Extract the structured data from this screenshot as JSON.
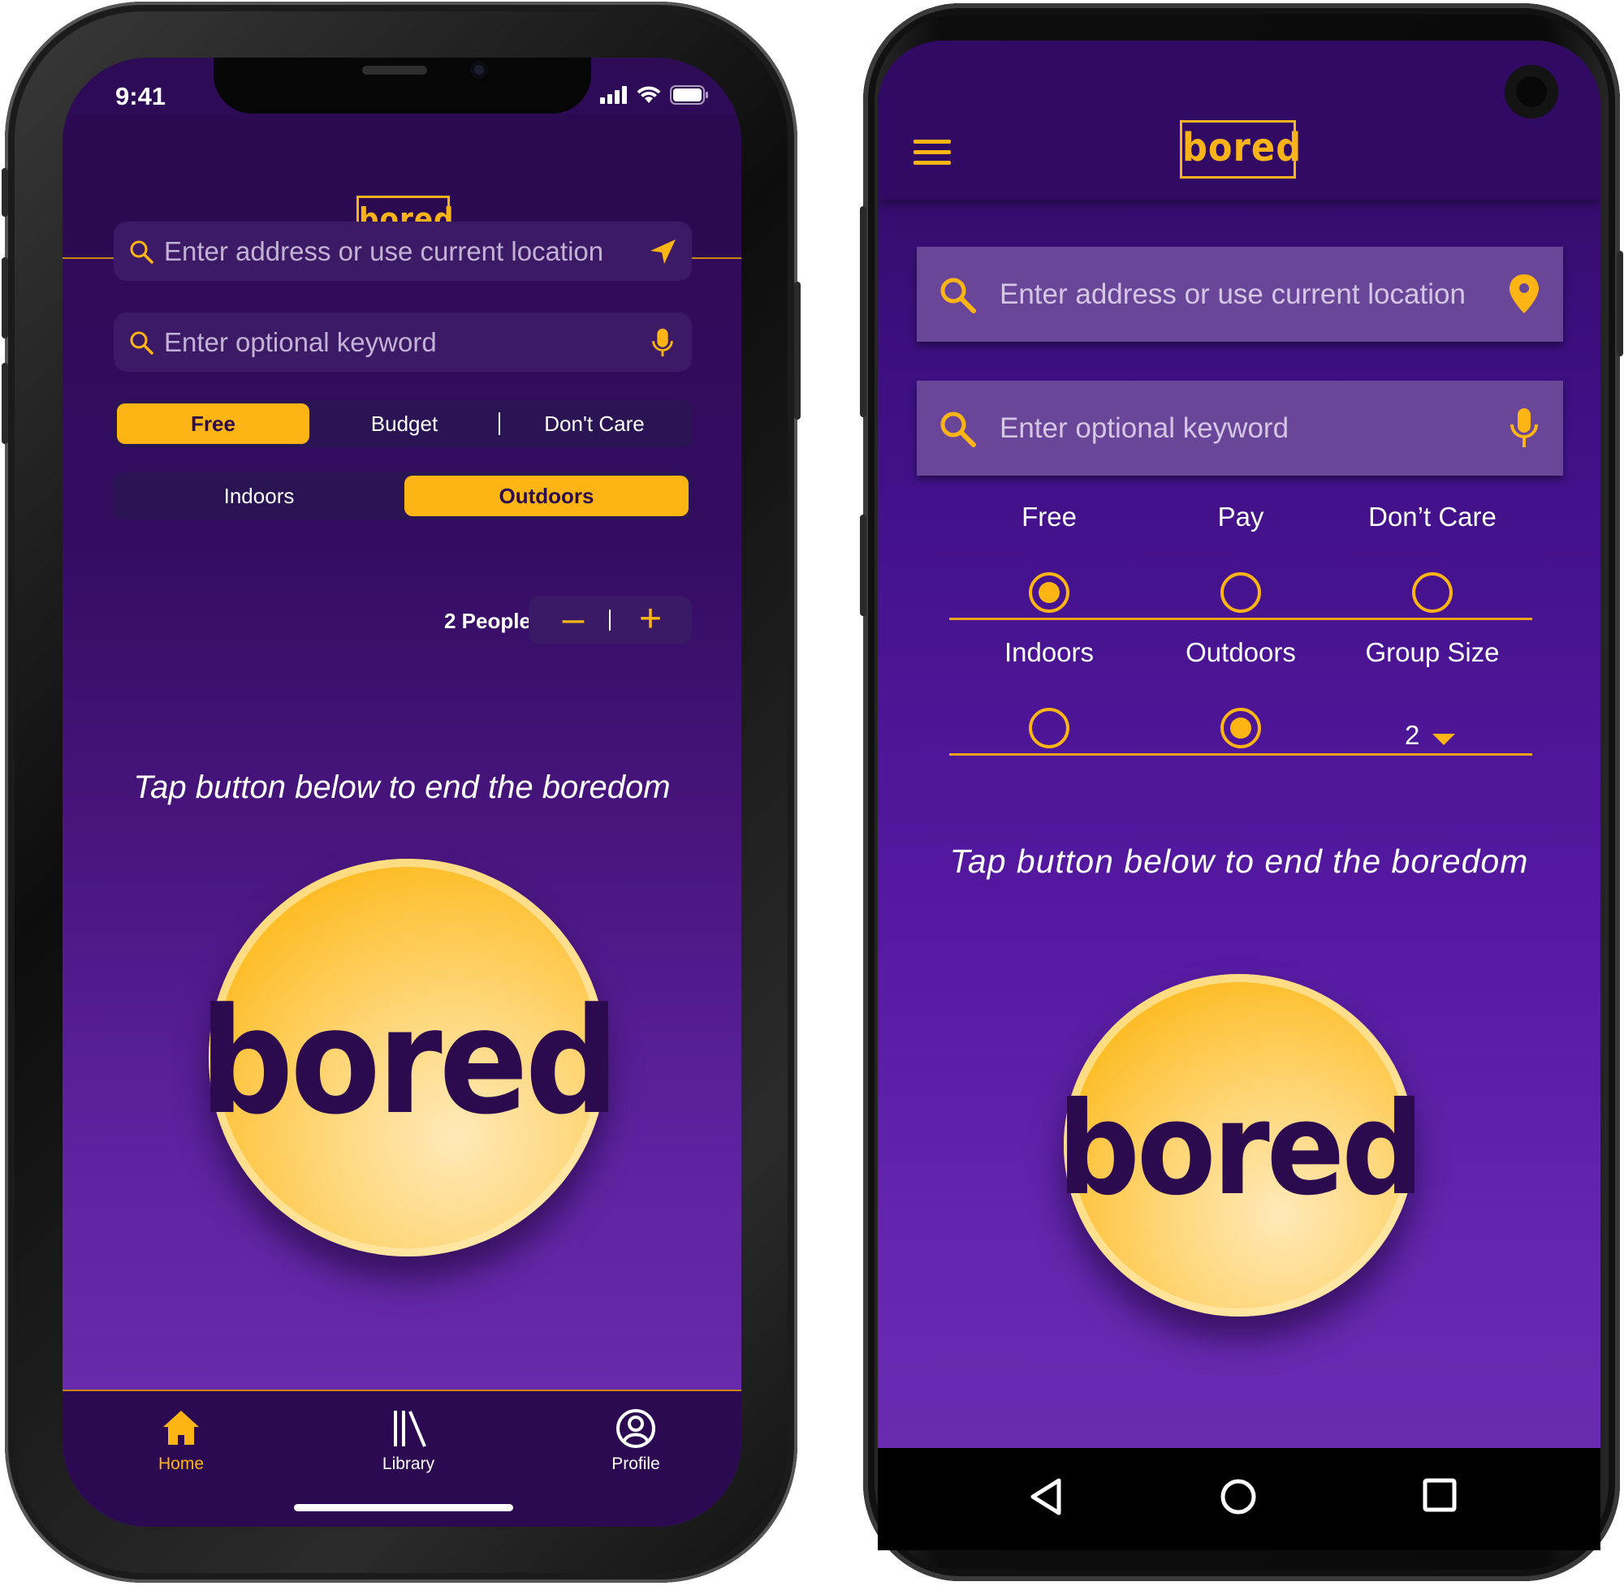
{
  "ios": {
    "status": {
      "time": "9:41"
    },
    "logo": "bored",
    "location_placeholder": "Enter address or use current location",
    "keyword_placeholder": "Enter optional keyword",
    "price_options": [
      "Free",
      "Budget",
      "Don't Care"
    ],
    "price_selected": "Free",
    "setting_options": [
      "Indoors",
      "Outdoors"
    ],
    "setting_selected": "Outdoors",
    "people_label": "2 People",
    "stepper": {
      "minus": "–",
      "plus": "+"
    },
    "tagline": "Tap button below to end the boredom",
    "button_text": "bored",
    "tabs": [
      {
        "label": "Home",
        "icon": "home-icon",
        "active": true
      },
      {
        "label": "Library",
        "icon": "library-icon",
        "active": false
      },
      {
        "label": "Profile",
        "icon": "profile-icon",
        "active": false
      }
    ]
  },
  "android": {
    "logo": "bored",
    "location_placeholder": "Enter address or use current location",
    "keyword_placeholder": "Enter optional keyword",
    "price_options": [
      "Free",
      "Pay",
      "Don’t Care"
    ],
    "price_selected": "Free",
    "setting_options": [
      "Indoors",
      "Outdoors"
    ],
    "setting_selected": "Outdoors",
    "group_size_label": "Group Size",
    "group_size_value": "2",
    "tagline": "Tap button below to end the boredom",
    "button_text": "bored",
    "nav_buttons": [
      "back-icon",
      "home-circle-icon",
      "recents-icon"
    ]
  },
  "colors": {
    "accent": "#fdb515",
    "header": "#2c0a52",
    "background_top": "#2e0b55",
    "background_bottom": "#6c2fb0"
  }
}
